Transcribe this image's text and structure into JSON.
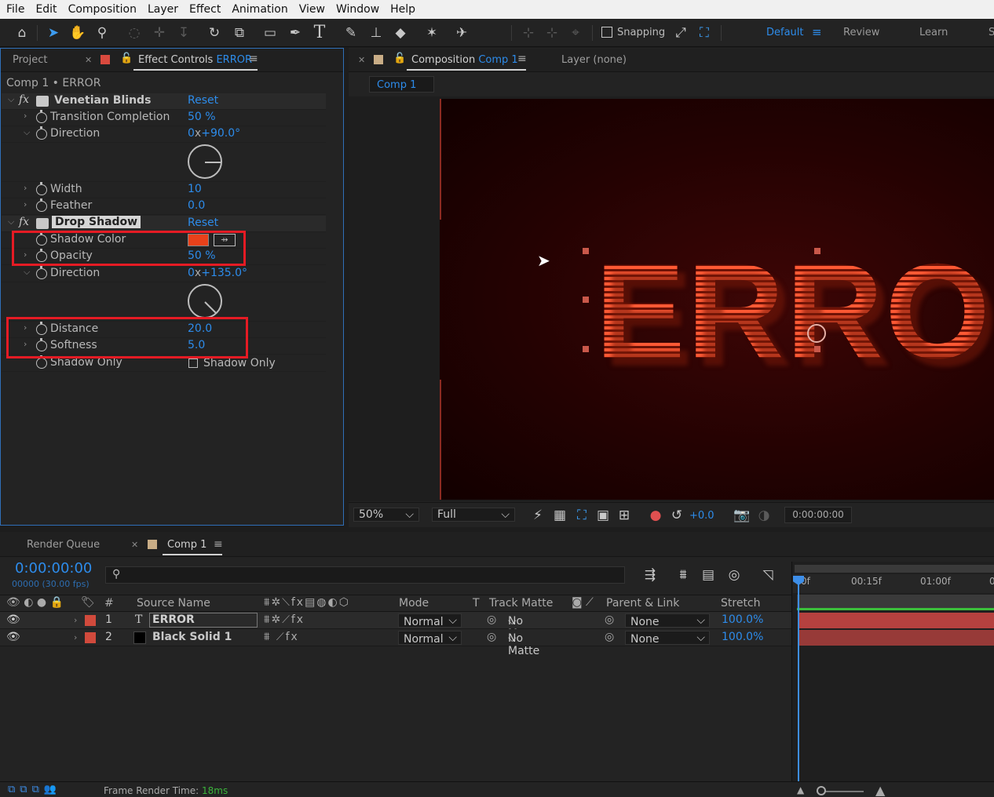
{
  "menu": [
    "File",
    "Edit",
    "Composition",
    "Layer",
    "Effect",
    "Animation",
    "View",
    "Window",
    "Help"
  ],
  "toolbar": {
    "snapping_label": "Snapping",
    "workspaces": [
      "Default",
      "Review",
      "Learn",
      "S"
    ]
  },
  "left_panel": {
    "tab_project": "Project",
    "tab_effect_controls": "Effect Controls",
    "tab_effect_controls_target": "ERROR",
    "breadcrumb": "Comp 1 • ERROR",
    "reset_label": "Reset",
    "venetian": {
      "name": "Venetian Blinds",
      "transition_label": "Transition Completion",
      "transition_value": "50 %",
      "direction_label": "Direction",
      "direction_value_prefix": "0",
      "direction_value": "+90.0°",
      "width_label": "Width",
      "width_value": "10",
      "feather_label": "Feather",
      "feather_value": "0.0"
    },
    "drop_shadow": {
      "name": "Drop Shadow",
      "shadow_color_label": "Shadow Color",
      "shadow_color_hex": "#e8411a",
      "opacity_label": "Opacity",
      "opacity_value": "50 %",
      "direction_label": "Direction",
      "direction_value_prefix": "0",
      "direction_value": "+135.0°",
      "distance_label": "Distance",
      "distance_value": "20.0",
      "softness_label": "Softness",
      "softness_value": "5.0",
      "shadow_only_label": "Shadow Only",
      "shadow_only_checkbox_label": "Shadow Only"
    }
  },
  "comp_panel": {
    "tab_label": "Composition",
    "tab_target": "Comp 1",
    "layer_tab": "Layer (none)",
    "sub_tab": "Comp 1",
    "canvas_text": "ERROR",
    "zoom": "50%",
    "resolution": "Full",
    "exposure": "+0.0",
    "timecode": "0:00:00:00"
  },
  "timeline": {
    "tab_render_queue": "Render Queue",
    "tab_comp": "Comp 1",
    "current_time": "0:00:00:00",
    "frame_info": "00000 (30.00 fps)",
    "search_placeholder": "",
    "headers": {
      "num": "#",
      "source_name": "Source Name",
      "mode": "Mode",
      "t": "T",
      "track_matte": "Track Matte",
      "parent": "Parent & Link",
      "stretch": "Stretch"
    },
    "ruler": [
      "0f",
      "00:15f",
      "01:00f",
      "0"
    ],
    "layers": [
      {
        "num": "1",
        "type": "T",
        "name": "ERROR",
        "mode": "Normal",
        "matte": "No Matte",
        "parent": "None",
        "stretch": "100.0%",
        "label_color": "#d14a3c"
      },
      {
        "num": "2",
        "type": "",
        "name": "Black Solid 1",
        "mode": "Normal",
        "matte": "No Matte",
        "parent": "None",
        "stretch": "100.0%",
        "label_color": "#d14a3c"
      }
    ]
  },
  "status": {
    "render_time_label": "Frame Render Time:",
    "render_time_value": "18ms"
  },
  "colors": {
    "accent": "#2d8ceb",
    "highlight": "#e51b24",
    "layer_bar": "#b5413f"
  }
}
